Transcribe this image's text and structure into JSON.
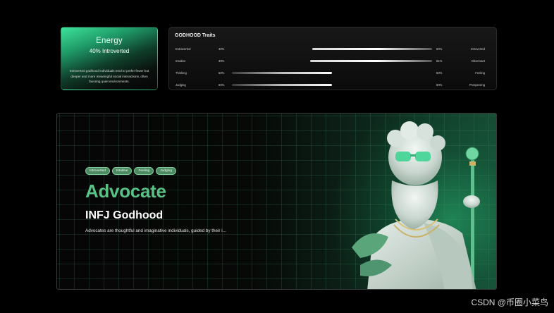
{
  "energy": {
    "title": "Energy",
    "subtitle": "40% Introverted",
    "description": "Introverted godhood individuals tend to prefer fewer but deeper and more meaningful social interactions, often favoring quiet environments."
  },
  "traits": {
    "heading": "GODHOOD Traits",
    "rows": [
      {
        "left": "Extraverted",
        "left_pct": "40%",
        "right_pct": "60%",
        "right": "Introverted",
        "fill_side": "right",
        "fill": 0.6
      },
      {
        "left": "Intuitive",
        "left_pct": "39%",
        "right_pct": "61%",
        "right": "Observant",
        "fill_side": "right",
        "fill": 0.61
      },
      {
        "left": "Thinking",
        "left_pct": "50%",
        "right_pct": "50%",
        "right": "Feeling",
        "fill_side": "left",
        "fill": 0.5
      },
      {
        "left": "Judging",
        "left_pct": "50%",
        "right_pct": "50%",
        "right": "Prospecting",
        "fill_side": "left",
        "fill": 0.5
      }
    ]
  },
  "hero": {
    "tags": [
      "Introverted",
      "Intuitive",
      "Feeling",
      "Judging"
    ],
    "title": "Advocate",
    "subtitle": "INFJ Godhood",
    "description": "Advocates are thoughtful and imaginative individuals, guided by their i..."
  },
  "watermark": "CSDN @币圈小菜鸟",
  "colors": {
    "accent_green": "#58c186",
    "tag_bg": "#4d8a62",
    "background": "#000000"
  }
}
